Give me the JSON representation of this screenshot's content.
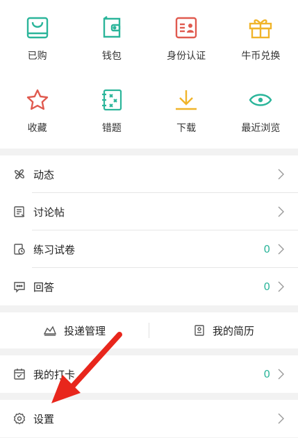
{
  "grid": [
    {
      "label": "已购",
      "icon": "purchased-bag-icon"
    },
    {
      "label": "钱包",
      "icon": "wallet-icon"
    },
    {
      "label": "身份认证",
      "icon": "id-card-icon"
    },
    {
      "label": "牛币兑换",
      "icon": "gift-icon"
    },
    {
      "label": "收藏",
      "icon": "star-icon"
    },
    {
      "label": "错题",
      "icon": "wrong-questions-icon"
    },
    {
      "label": "下载",
      "icon": "download-icon"
    },
    {
      "label": "最近浏览",
      "icon": "eye-icon"
    }
  ],
  "list1": [
    {
      "label": "动态",
      "count": ""
    },
    {
      "label": "讨论帖",
      "count": ""
    },
    {
      "label": "练习试卷",
      "count": "0"
    },
    {
      "label": "回答",
      "count": "0"
    }
  ],
  "split": {
    "left": "投递管理",
    "right": "我的简历"
  },
  "checkin": {
    "label": "我的打卡",
    "count": "0"
  },
  "settings": {
    "label": "设置"
  },
  "colors": {
    "teal": "#2bb59a",
    "red": "#e05a4f",
    "gold": "#f0b429",
    "arrow": "#e8261c"
  }
}
